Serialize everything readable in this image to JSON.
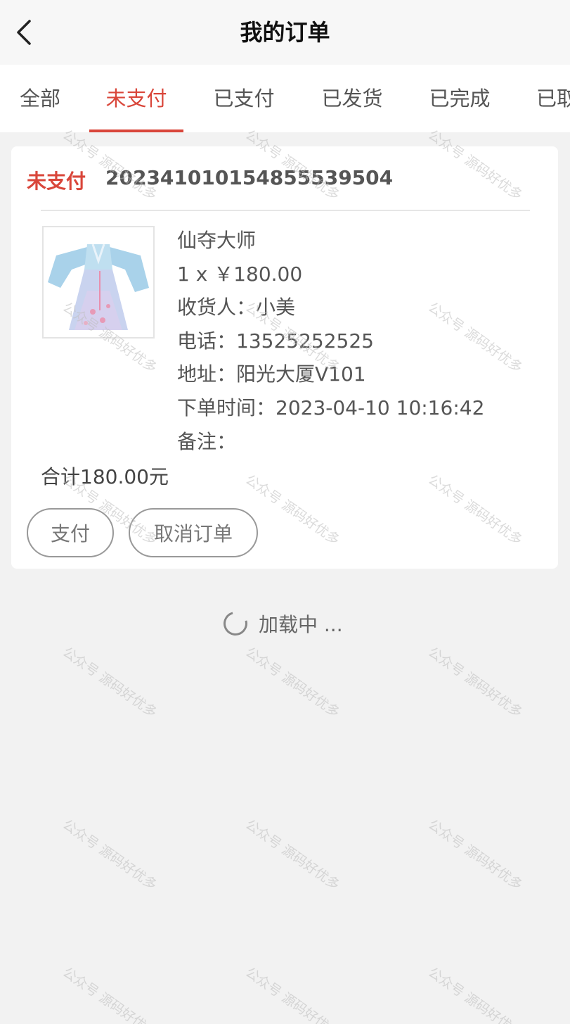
{
  "header": {
    "title": "我的订单",
    "back_icon": "chevron-left-icon"
  },
  "tabs": [
    {
      "label": "全部",
      "active": false
    },
    {
      "label": "未支付",
      "active": true
    },
    {
      "label": "已支付",
      "active": false
    },
    {
      "label": "已发货",
      "active": false
    },
    {
      "label": "已完成",
      "active": false
    },
    {
      "label": "已取消",
      "active": false
    }
  ],
  "order": {
    "status": "未支付",
    "order_no": "20234101015485553950​4",
    "product_name": "仙夺大师",
    "qty_price": "1 x ￥180.00",
    "receiver": "收货人：小美",
    "phone": "电话：13525252525",
    "address": "地址：阳光大厦V101",
    "order_time": "下单时间：2023-04-10 10:16:42",
    "remark": "备注：",
    "total": "合计180.00元",
    "pay_label": "支付",
    "cancel_label": "取消订单"
  },
  "loading": {
    "text": "加载中 ..."
  },
  "colors": {
    "accent": "#d9463a",
    "background": "#f2f2f2"
  },
  "watermark": "公众号 源码好优多"
}
